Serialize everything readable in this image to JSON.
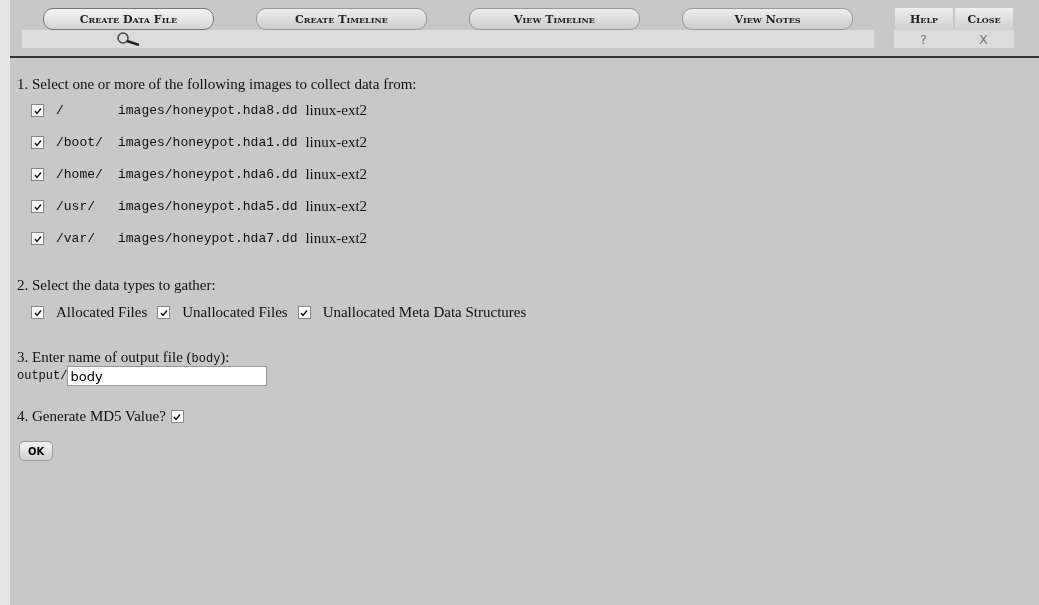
{
  "nav": [
    {
      "label": "Create Data File",
      "selected": true
    },
    {
      "label": "Create Timeline",
      "selected": false
    },
    {
      "label": "View Timeline",
      "selected": false
    },
    {
      "label": "View Notes",
      "selected": false
    }
  ],
  "side_buttons": [
    {
      "label": "Help",
      "glyph": "?"
    },
    {
      "label": "Close",
      "glyph": "X"
    }
  ],
  "step1": {
    "heading": "1. Select one or more of the following images to collect data from:",
    "images": [
      {
        "mount": "/",
        "path": "images/honeypot.hda8.dd",
        "fs": "linux-ext2",
        "checked": true
      },
      {
        "mount": "/boot/",
        "path": "images/honeypot.hda1.dd",
        "fs": "linux-ext2",
        "checked": true
      },
      {
        "mount": "/home/",
        "path": "images/honeypot.hda6.dd",
        "fs": "linux-ext2",
        "checked": true
      },
      {
        "mount": "/usr/",
        "path": "images/honeypot.hda5.dd",
        "fs": "linux-ext2",
        "checked": true
      },
      {
        "mount": "/var/",
        "path": "images/honeypot.hda7.dd",
        "fs": "linux-ext2",
        "checked": true
      }
    ]
  },
  "step2": {
    "heading": "2. Select the data types to gather:",
    "types": [
      {
        "label": "Allocated Files",
        "checked": true
      },
      {
        "label": "Unallocated Files",
        "checked": true
      },
      {
        "label": "Unallocated Meta Data Structures",
        "checked": true
      }
    ]
  },
  "step3": {
    "heading_before": "3. Enter name of output file (",
    "heading_code": "body",
    "heading_after": "):",
    "prefix": "output/",
    "value": "body"
  },
  "step4": {
    "label": "4. Generate MD5 Value?",
    "checked": true
  },
  "ok_button": "OK"
}
